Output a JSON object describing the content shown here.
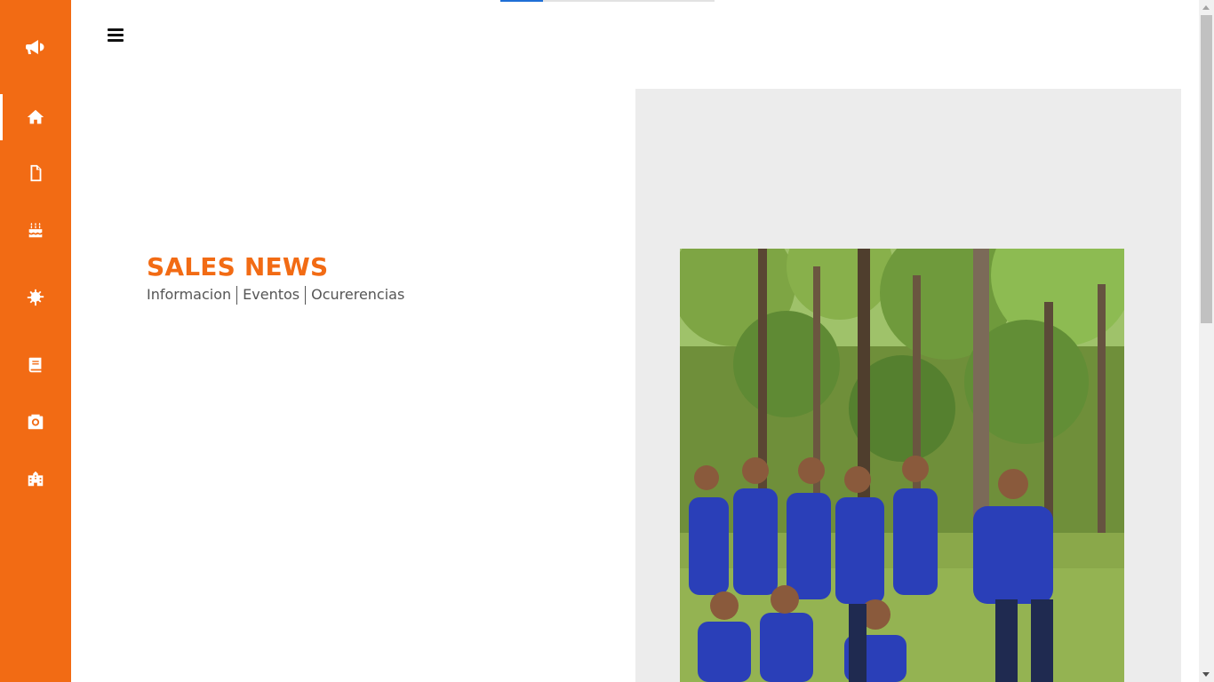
{
  "sidebar": {
    "brand_icon": "megaphone-icon",
    "items": [
      {
        "icon": "home-icon",
        "active": true
      },
      {
        "icon": "file-icon",
        "active": false
      },
      {
        "icon": "birthday-cake-icon",
        "active": false
      },
      {
        "icon": "virus-icon",
        "active": false
      },
      {
        "icon": "book-icon",
        "active": false
      },
      {
        "icon": "camera-icon",
        "active": false
      },
      {
        "icon": "school-icon",
        "active": false
      }
    ],
    "background": "#f26b14"
  },
  "top_indicator": {
    "progress": 0.2
  },
  "header": {
    "menu_icon": "hamburger-menu-icon"
  },
  "hero": {
    "title": "SALES NEWS",
    "links": [
      "Informacion",
      "Eventos",
      "Ocurerencias"
    ]
  },
  "photo": {
    "description_icon": "group-photo"
  },
  "colors": {
    "accent": "#f26b14",
    "indicator": "#1f6fd6"
  }
}
